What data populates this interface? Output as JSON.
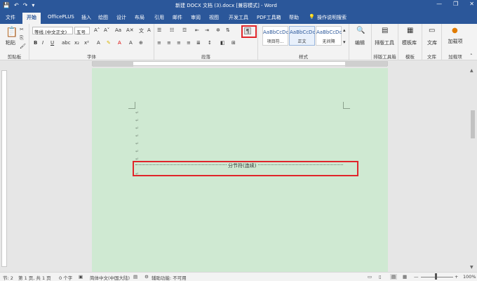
{
  "window": {
    "title": "新建 DOCX 文档 (3).docx [兼容模式] - Word",
    "controls": [
      "minimize-icon",
      "restore-icon",
      "close-icon"
    ]
  },
  "qat": {
    "save": "💾",
    "undo": "↶",
    "redo": "↷",
    "more": "▾"
  },
  "tabs": [
    {
      "label": "文件"
    },
    {
      "label": "开始"
    },
    {
      "label": "OfficePLUS"
    },
    {
      "label": "插入"
    },
    {
      "label": "绘图"
    },
    {
      "label": "设计"
    },
    {
      "label": "布局"
    },
    {
      "label": "引用"
    },
    {
      "label": "邮件"
    },
    {
      "label": "审阅"
    },
    {
      "label": "视图"
    },
    {
      "label": "开发工具"
    },
    {
      "label": "PDF工具箱"
    },
    {
      "label": "帮助"
    },
    {
      "label": "操作说明搜索"
    }
  ],
  "ribbon": {
    "clipboard": {
      "paste": "粘贴",
      "label": "剪贴板"
    },
    "font": {
      "family": "等线 (中文正文)",
      "size": "五号",
      "label": "字体",
      "bold": "B",
      "italic": "I",
      "underline": "U"
    },
    "paragraph": {
      "label": "段落"
    },
    "styles": {
      "label": "样式",
      "items": [
        {
          "preview": "AaBbCcDc",
          "name": "项目符..."
        },
        {
          "preview": "AaBbCcDc",
          "name": "正文"
        },
        {
          "preview": "AaBbCcDc",
          "name": "无间隔"
        }
      ]
    },
    "editing": {
      "label": "编辑"
    },
    "layout_tools": {
      "button": "排版工具",
      "label": "排版工具箱"
    },
    "templates": {
      "button": "模板库",
      "label": "模板"
    },
    "library": {
      "button": "文库",
      "label": "文库"
    },
    "addins": {
      "button": "加载项",
      "label": "加载项"
    }
  },
  "document": {
    "section_break_text": "分节符(连续)",
    "paragraph_mark": "↵"
  },
  "statusbar": {
    "section": "节: 2",
    "page": "第 1 页, 共 1 页",
    "words": "0 个字",
    "language": "简体中文(中国大陆)",
    "accessibility": "辅助功能: 不可用",
    "zoom": "100%",
    "zoom_level": 1.0
  }
}
